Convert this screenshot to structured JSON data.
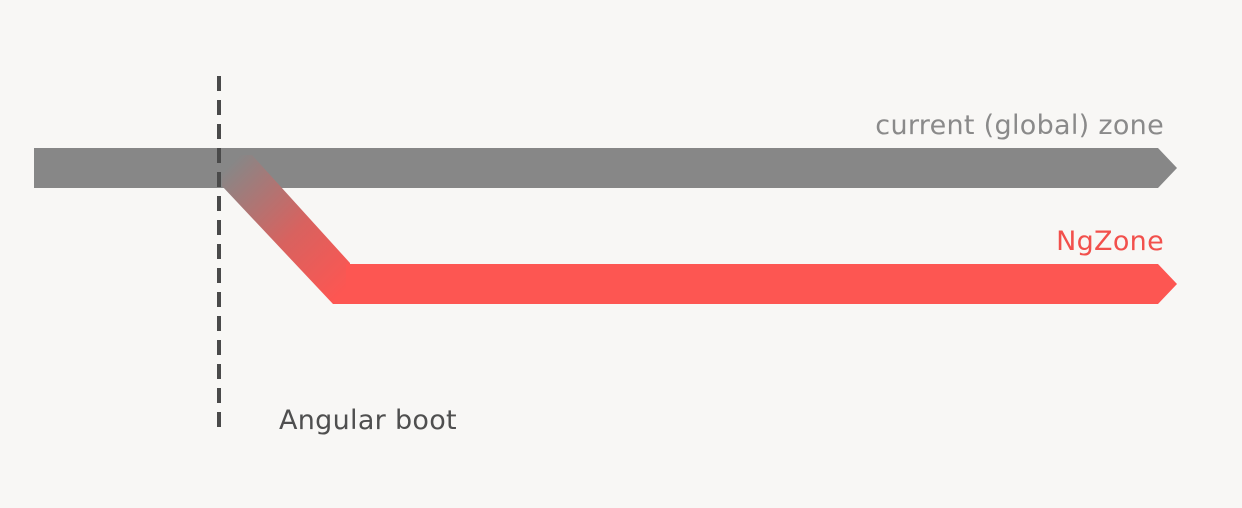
{
  "labels": {
    "global_zone": "current (global) zone",
    "ngzone": "NgZone",
    "boot": "Angular boot"
  },
  "colors": {
    "background": "#f8f7f5",
    "global_zone": "#878787",
    "global_zone_label": "#8a8a8a",
    "ngzone": "#fd5652",
    "ngzone_label": "#f2504c",
    "boot_line": "#4a4a4a",
    "boot_label": "#4f4f4f"
  }
}
